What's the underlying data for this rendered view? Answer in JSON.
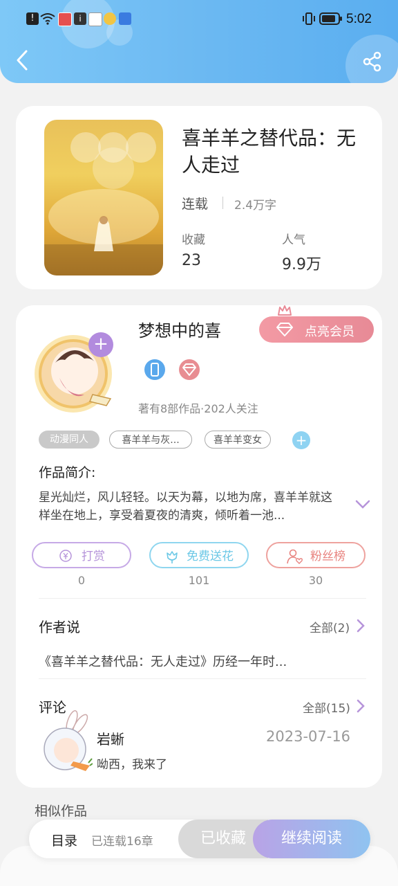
{
  "status_bar": {
    "time": "5:02"
  },
  "book": {
    "title": "喜羊羊之替代品：无人走过",
    "status": "连载",
    "word_count": "2.4万字",
    "favorites_label": "收藏",
    "favorites_value": "23",
    "popularity_label": "人气",
    "popularity_value": "9.9万"
  },
  "author": {
    "name": "梦想中的喜",
    "vip_label": "点亮会员",
    "stats": "著有8部作品·202人关注",
    "tags": [
      "动漫同人",
      "喜羊羊与灰...",
      "喜羊羊变女"
    ],
    "intro_label": "作品简介:",
    "intro_text": "星光灿烂，风儿轻轻。以天为幕，以地为席，喜羊羊就这样坐在地上，享受着夏夜的清爽，倾听着一池..."
  },
  "actions": [
    {
      "label": "打赏",
      "count": "0"
    },
    {
      "label": "免费送花",
      "count": "101"
    },
    {
      "label": "粉丝榜",
      "count": "30"
    }
  ],
  "author_says": {
    "title": "作者说",
    "all_label": "全部(2)",
    "preview": "《喜羊羊之替代品：无人走过》历经一年时..."
  },
  "comments": {
    "title": "评论",
    "all_label": "全部(15)",
    "items": [
      {
        "user": "岩蜥",
        "date": "2023-07-16",
        "text": "呦西，我来了"
      }
    ]
  },
  "similar_title": "相似作品",
  "bottom_bar": {
    "toc_label": "目录",
    "chapters": "已连载16章",
    "collected_label": "已收藏",
    "continue_label": "继续阅读"
  },
  "colors": {
    "header": "#6cb9f2",
    "vip": "#e98a96",
    "reward": "#b694da",
    "flower": "#6cc8e6",
    "fans": "#e8837f",
    "continue_start": "#b9a3e6",
    "continue_end": "#8fc3f0"
  }
}
